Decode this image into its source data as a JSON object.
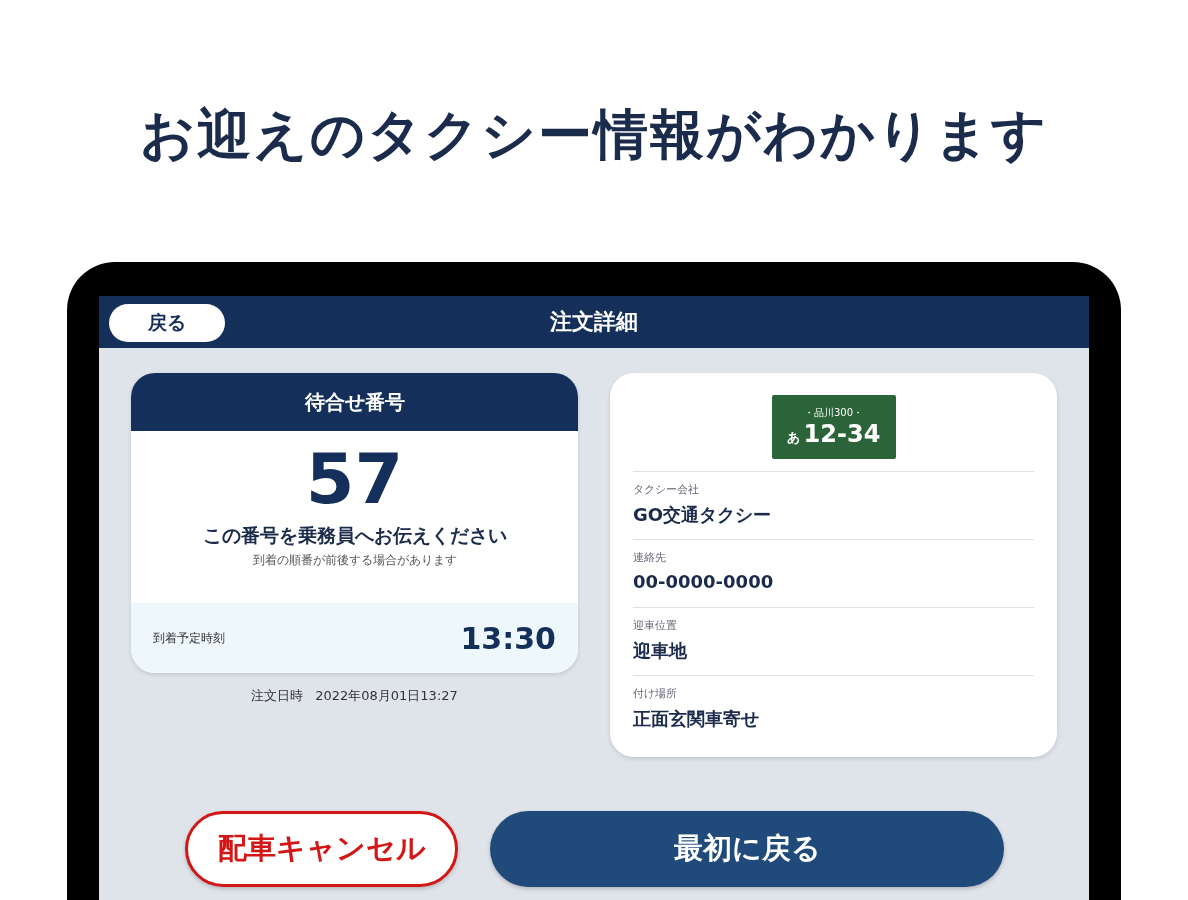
{
  "headline": "お迎えのタクシー情報がわかります",
  "header": {
    "back_button": "戻る",
    "title": "注文詳細"
  },
  "waiting_card": {
    "title": "待合せ番号",
    "number": "57",
    "message": "この番号を乗務員へお伝えください",
    "note": "到着の順番が前後する場合があります",
    "arrival_label": "到着予定時刻",
    "arrival_time": "13:30"
  },
  "order_datetime": {
    "label": "注文日時",
    "value": "2022年08月01日13:27"
  },
  "plate": {
    "region": "・品川300・",
    "kana": "あ",
    "number": "12-34"
  },
  "details": [
    {
      "label": "タクシー会社",
      "value": "GO交通タクシー"
    },
    {
      "label": "連絡先",
      "value": "00-0000-0000"
    },
    {
      "label": "迎車位置",
      "value": "迎車地"
    },
    {
      "label": "付け場所",
      "value": "正面玄関車寄せ"
    }
  ],
  "buttons": [
    {
      "kind": "outline",
      "label": "配車キャンセル"
    },
    {
      "kind": "primary",
      "label": "最初に戻る"
    }
  ]
}
